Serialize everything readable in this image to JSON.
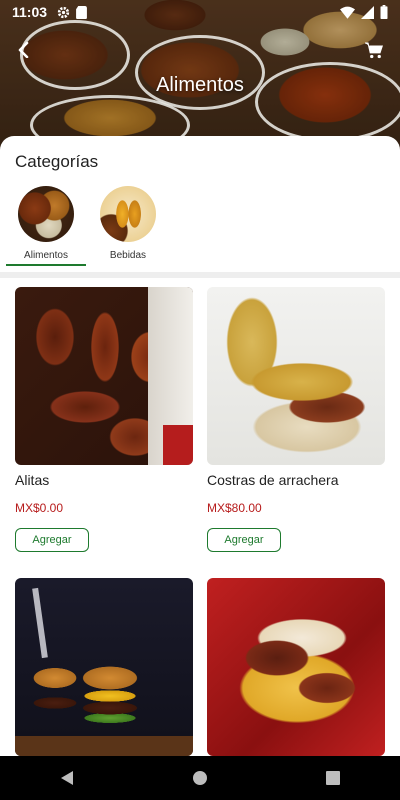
{
  "status_bar": {
    "time": "11:03",
    "icons_left": [
      "gear-icon",
      "sd-card-icon"
    ],
    "icons_right": [
      "wifi-icon",
      "signal-icon",
      "battery-icon"
    ]
  },
  "header": {
    "title": "Alimentos",
    "back_icon": "back-arrow-icon",
    "cart_icon": "cart-icon"
  },
  "categories": {
    "title": "Categorías",
    "items": [
      {
        "label": "Alimentos",
        "selected": true
      },
      {
        "label": "Bebidas",
        "selected": false
      }
    ]
  },
  "products": [
    {
      "name": "Alitas",
      "price": "MX$0.00",
      "button": "Agregar"
    },
    {
      "name": "Costras de arrachera",
      "price": "MX$80.00",
      "button": "Agregar"
    },
    {
      "name": "",
      "price": "",
      "button": ""
    },
    {
      "name": "",
      "price": "",
      "button": ""
    }
  ],
  "colors": {
    "accent": "#1e7a2e",
    "price": "#b71c1c"
  },
  "navbar": {
    "icons": [
      "back-triangle-icon",
      "home-circle-icon",
      "recents-square-icon"
    ]
  }
}
